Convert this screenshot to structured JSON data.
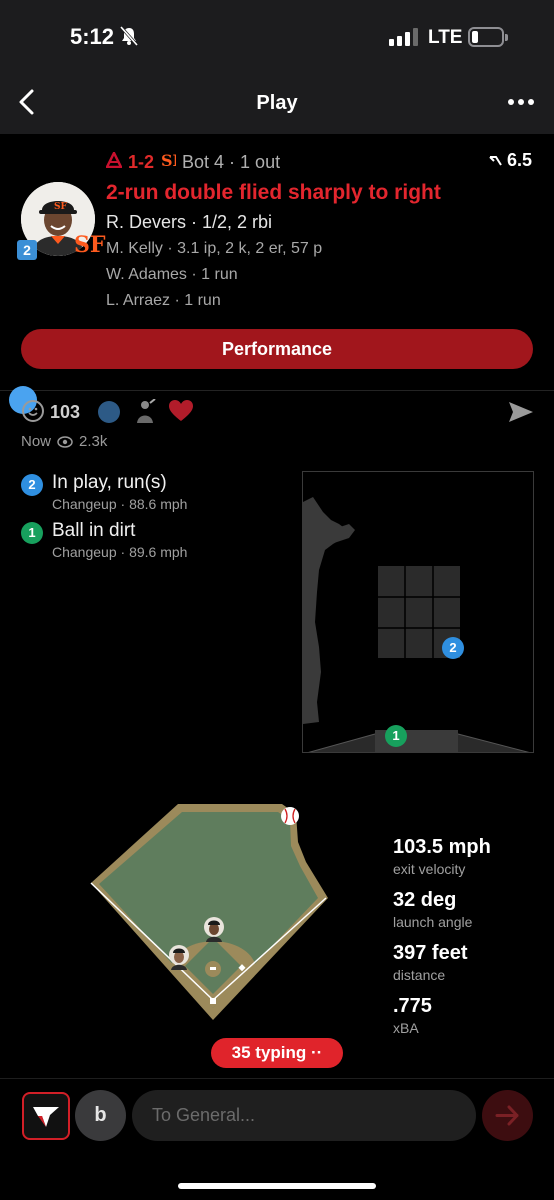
{
  "status_bar": {
    "time": "5:12",
    "network": "LTE"
  },
  "nav": {
    "title": "Play"
  },
  "play": {
    "score": "1-2",
    "inning_state": "Bot 4 · 1 out",
    "win_prob_change": "6.5",
    "headline": "2-run double flied sharply to right",
    "batter_line": "R. Devers · 1/2, 2 rbi",
    "pitcher_line": "M. Kelly · 3.1 ip, 2 k, 2 er, 57 p",
    "runner_1": "W. Adames · 1 run",
    "runner_2": "L. Arraez · 1 run",
    "player_badge": "2",
    "team_logo": "SF",
    "performance_button": "Performance",
    "accent_color": "#e3262e"
  },
  "reactions": {
    "count": "103",
    "posted": "Now",
    "views": "2.3k"
  },
  "pitches": [
    {
      "number": "2",
      "result": "In play, run(s)",
      "pitch_type": "Changeup",
      "speed": "88.6 mph",
      "color": "#2f8fe0"
    },
    {
      "number": "1",
      "result": "Ball in dirt",
      "pitch_type": "Changeup",
      "speed": "89.6 mph",
      "color": "#17a05d"
    }
  ],
  "batted_ball": {
    "exit_velocity": "103.5 mph",
    "exit_velocity_label": "exit velocity",
    "launch_angle": "32 deg",
    "launch_angle_label": "launch angle",
    "distance": "397 feet",
    "distance_label": "distance",
    "xba": ".775",
    "xba_label": "xBA"
  },
  "typing_indicator": "35 typing ··",
  "compose": {
    "avatar_letter": "b",
    "placeholder": "To General..."
  }
}
